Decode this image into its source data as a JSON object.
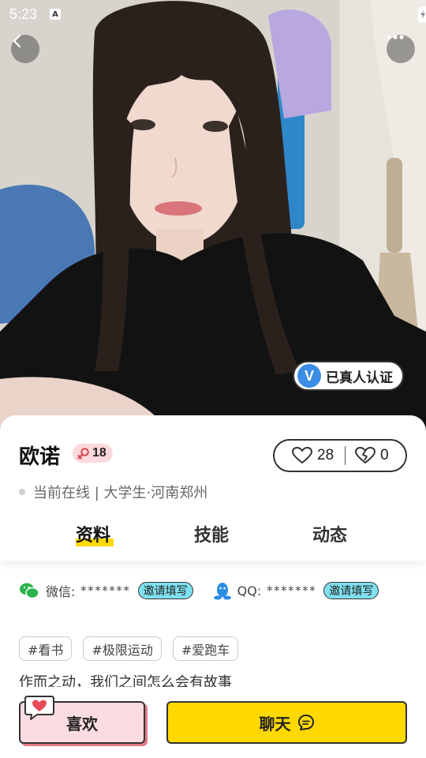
{
  "status_bar": {
    "time": "5:23",
    "notification_icon_letter": "A"
  },
  "hero": {
    "verified_label": "已真人认证",
    "verified_icon_letter": "V"
  },
  "profile": {
    "name": "欧诺",
    "age": "18",
    "likes": "28",
    "broken_hearts": "0",
    "status_text": "当前在线 | 大学生·河南郑州"
  },
  "tabs": [
    {
      "label": "资料",
      "active": true
    },
    {
      "label": "技能",
      "active": false
    },
    {
      "label": "动态",
      "active": false
    }
  ],
  "contacts": {
    "wechat": {
      "label": "微信:",
      "value": "*******",
      "invite": "邀请填写"
    },
    "qq": {
      "label": "QQ:",
      "value": "*******",
      "invite": "邀请填写"
    }
  },
  "tags": [
    "#看书",
    "#极限运动",
    "#爱跑车"
  ],
  "bio": "作而之动，我们之间怎么会有故事",
  "actions": {
    "like_label": "喜欢",
    "chat_label": "聊天"
  },
  "colors": {
    "accent_yellow": "#ffd900",
    "pink": "#fcdce0",
    "invite_blue": "#7fe0f0",
    "verified_blue": "#3b8de5"
  }
}
